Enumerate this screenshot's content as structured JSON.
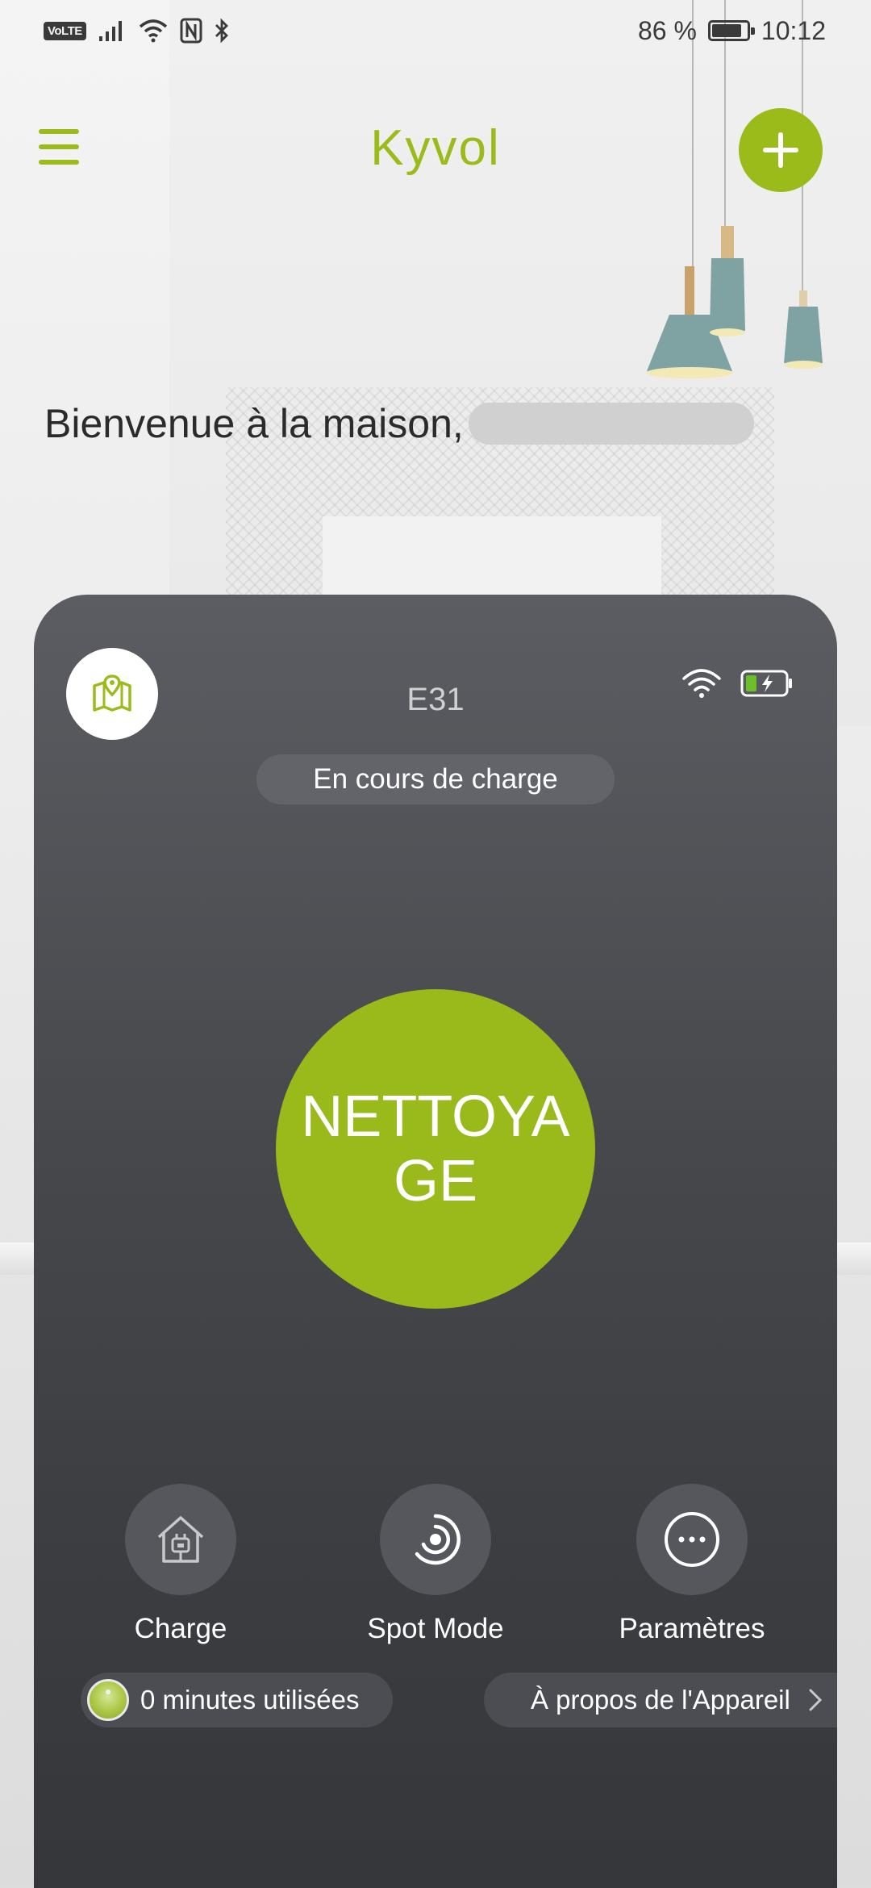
{
  "status_bar": {
    "volte": "VoLTE",
    "battery_percent_text": "86 %",
    "battery_level": 0.86,
    "time": "10:12",
    "icons": [
      "signal-icon",
      "wifi-icon",
      "nfc-icon",
      "bluetooth-icon",
      "battery-icon"
    ]
  },
  "header": {
    "logo": "Kyvol",
    "menu_icon": "hamburger-menu-icon",
    "add_icon": "plus-icon"
  },
  "welcome": {
    "text": "Bienvenue à la maison,"
  },
  "device": {
    "name": "E31",
    "status": "En cours de charge",
    "map_icon": "map-icon",
    "wifi_icon": "wifi-icon",
    "battery_icon": "charging-battery-icon",
    "clean_button": "NETTOYAGE",
    "actions": [
      {
        "label": "Charge",
        "icon": "home-charge-icon"
      },
      {
        "label": "Spot Mode",
        "icon": "spot-mode-icon"
      },
      {
        "label": "Paramètres",
        "icon": "more-options-icon"
      }
    ],
    "usage": "0 minutes utilisées",
    "about": "À propos de l'Appareil"
  },
  "colors": {
    "accent": "#9bbb1a",
    "card_top": "#5b5d62",
    "card_bottom": "#333539",
    "text_light": "#ffffff"
  }
}
